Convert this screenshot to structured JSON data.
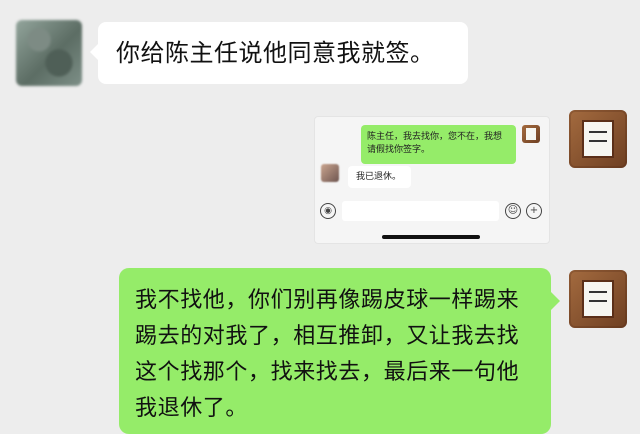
{
  "messages": [
    {
      "sender": "other",
      "text": "你给陈主任说他同意我就签。"
    },
    {
      "sender": "me",
      "type": "image",
      "screenshot": {
        "outgoing_text": "陈主任，我去找你，您不在，我想请假找你签字。",
        "incoming_text": "我已退休。"
      }
    },
    {
      "sender": "me",
      "text": "我不找他，你们别再像踢皮球一样踢来踢去的对我了，相互推卸，又让我去找这个找那个，找来找去，最后来一句他我退休了。"
    }
  ],
  "icons": {
    "voice": "voice-icon",
    "emoji": "emoji-icon",
    "plus": "plus-icon"
  },
  "colors": {
    "chat_bg": "#ededed",
    "incoming_bubble": "#ffffff",
    "outgoing_bubble": "#95ec69"
  }
}
